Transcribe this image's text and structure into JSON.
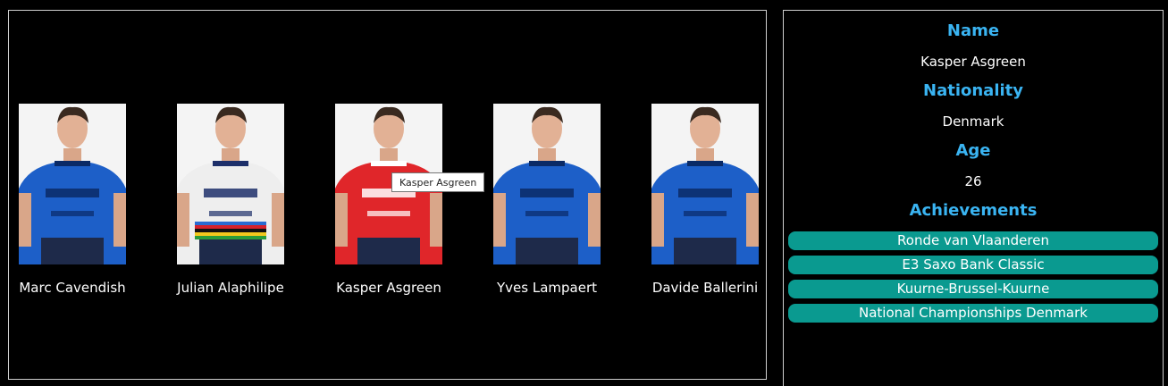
{
  "riders": [
    {
      "name": "Marc Cavendish",
      "jersey": "#1d5fc8",
      "accent": "#0a2a66"
    },
    {
      "name": "Julian Alaphilipe",
      "jersey": "#eeeeee",
      "accent": "#1d2f6a"
    },
    {
      "name": "Kasper Asgreen",
      "jersey": "#e0262a",
      "accent": "#ffffff"
    },
    {
      "name": "Yves Lampaert",
      "jersey": "#1d5fc8",
      "accent": "#0a2a66"
    },
    {
      "name": "Davide Ballerini",
      "jersey": "#1d5fc8",
      "accent": "#0a2a66"
    }
  ],
  "tooltip": {
    "text": "Kasper Asgreen"
  },
  "details": {
    "name_label": "Name",
    "name_value": "Kasper Asgreen",
    "nationality_label": "Nationality",
    "nationality_value": "Denmark",
    "age_label": "Age",
    "age_value": "26",
    "achievements_label": "Achievements",
    "achievements": [
      "Ronde van Vlaanderen",
      "E3 Saxo Bank Classic",
      "Kuurne-Brussel-Kuurne",
      "National Championships Denmark"
    ]
  },
  "colors": {
    "label": "#3ab4f2",
    "achievement_bg": "#0a9a90",
    "border": "#cfcfcf"
  }
}
